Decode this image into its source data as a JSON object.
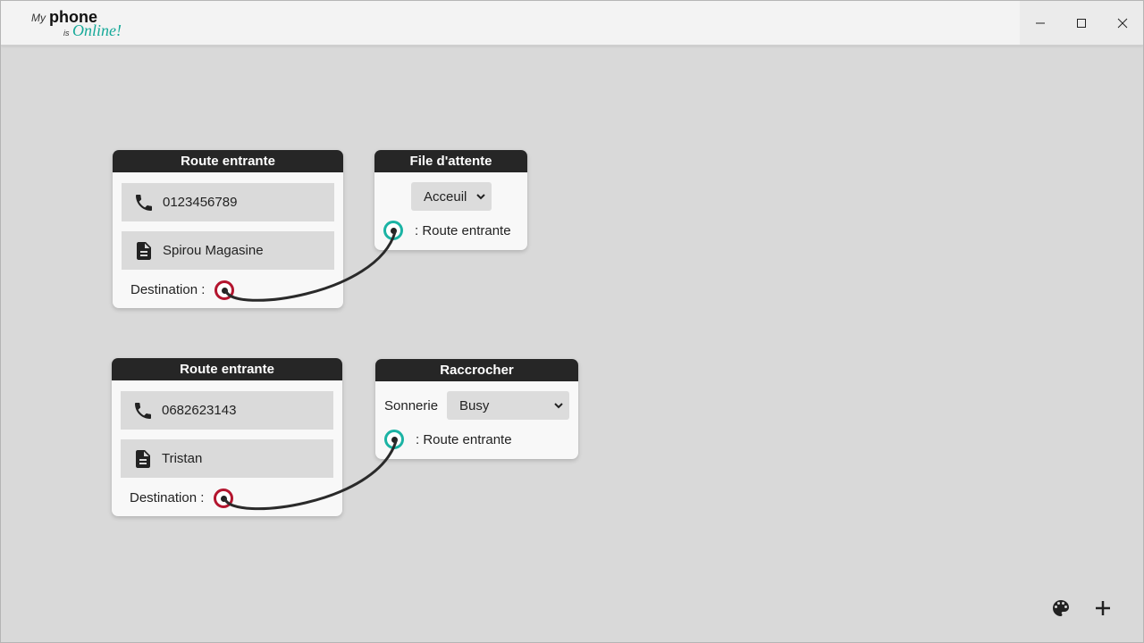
{
  "app": {
    "logo": {
      "my": "My",
      "phone": "phone",
      "is": "is",
      "online": "Online!"
    },
    "accent_color": "#16a999",
    "window_controls": [
      "minimize-icon",
      "maximize-icon",
      "close-icon"
    ]
  },
  "nodes": {
    "route1": {
      "title": "Route entrante",
      "phone": "0123456789",
      "name": "Spirou Magasine",
      "destination_label": "Destination :"
    },
    "queue": {
      "title": "File d'attente",
      "select_value": "Acceuil",
      "input_label": ": Route entrante"
    },
    "route2": {
      "title": "Route entrante",
      "phone": "0682623143",
      "name": "Tristan",
      "destination_label": "Destination :"
    },
    "hangup": {
      "title": "Raccrocher",
      "sonnerie_label": "Sonnerie",
      "select_value": "Busy",
      "input_label": ": Route entrante"
    }
  },
  "colors": {
    "node_header": "#262626",
    "port_out": "#b3152e",
    "port_in": "#1bb3a4",
    "canvas": "#d9d9d9"
  },
  "toolbar": {
    "icons": [
      "palette-icon",
      "plus-icon"
    ]
  }
}
